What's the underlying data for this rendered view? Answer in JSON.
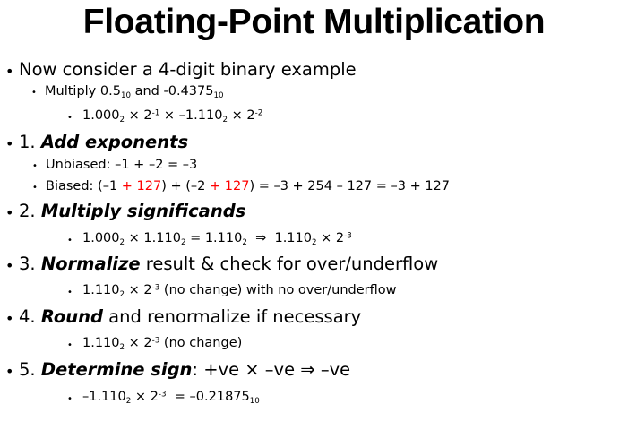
{
  "slide": {
    "title": "Floating-Point Multiplication",
    "l01": {
      "text": "Now consider a 4-digit binary example"
    },
    "l02": {
      "t1": "Multiply 0.5",
      "sub1": "10",
      "t2": " and -0.4375",
      "sub2": "10"
    },
    "l03": {
      "t1": "1.000",
      "sub1": "2",
      "t2": " × 2",
      "sup1": "-1",
      "t3": " × –1.110",
      "sub2": "2",
      "t4": " × 2",
      "sup2": "-2"
    },
    "l04": {
      "num": "1. ",
      "bold": "Add exponents"
    },
    "l05": {
      "text": "Unbiased: –1 + –2 = –3"
    },
    "l06": {
      "t1": "Biased: (–1 ",
      "r1": "+ 127",
      "t2": ") + (–2 ",
      "r2": "+ 127",
      "t3": ") = –3 + 254 – 127 = –3 + 127"
    },
    "l07": {
      "num": "2. ",
      "bold": "Multiply significands"
    },
    "l08": {
      "t1": "1.000",
      "sub1": "2",
      "t2": " × 1.110",
      "sub2": "2",
      "t3": " = 1.110",
      "sub3": "2",
      "t4": "  ⇒  1.110",
      "sub4": "2",
      "t5": " × 2",
      "sup1": "-3"
    },
    "l09": {
      "num": "3. ",
      "bold": "Normalize",
      "rest": " result & check for over/underflow"
    },
    "l10": {
      "t1": "1.110",
      "sub1": "2",
      "t2": " × 2",
      "sup1": "-3",
      "t3": " (no change) with no over/underflow"
    },
    "l11": {
      "num": "4. ",
      "bold": "Round",
      "rest": " and renormalize if necessary"
    },
    "l12": {
      "t1": "1.110",
      "sub1": "2",
      "t2": " × 2",
      "sup1": "-3",
      "t3": " (no change)"
    },
    "l13": {
      "num": "5. ",
      "bold": "Determine sign",
      "rest": ": +ve × –ve ⇒ –ve"
    },
    "l14": {
      "t1": "–1.110",
      "sub1": "2",
      "t2": " × 2",
      "sup1": "-3",
      "t3": "  = –0.21875",
      "sub2": "10"
    }
  }
}
